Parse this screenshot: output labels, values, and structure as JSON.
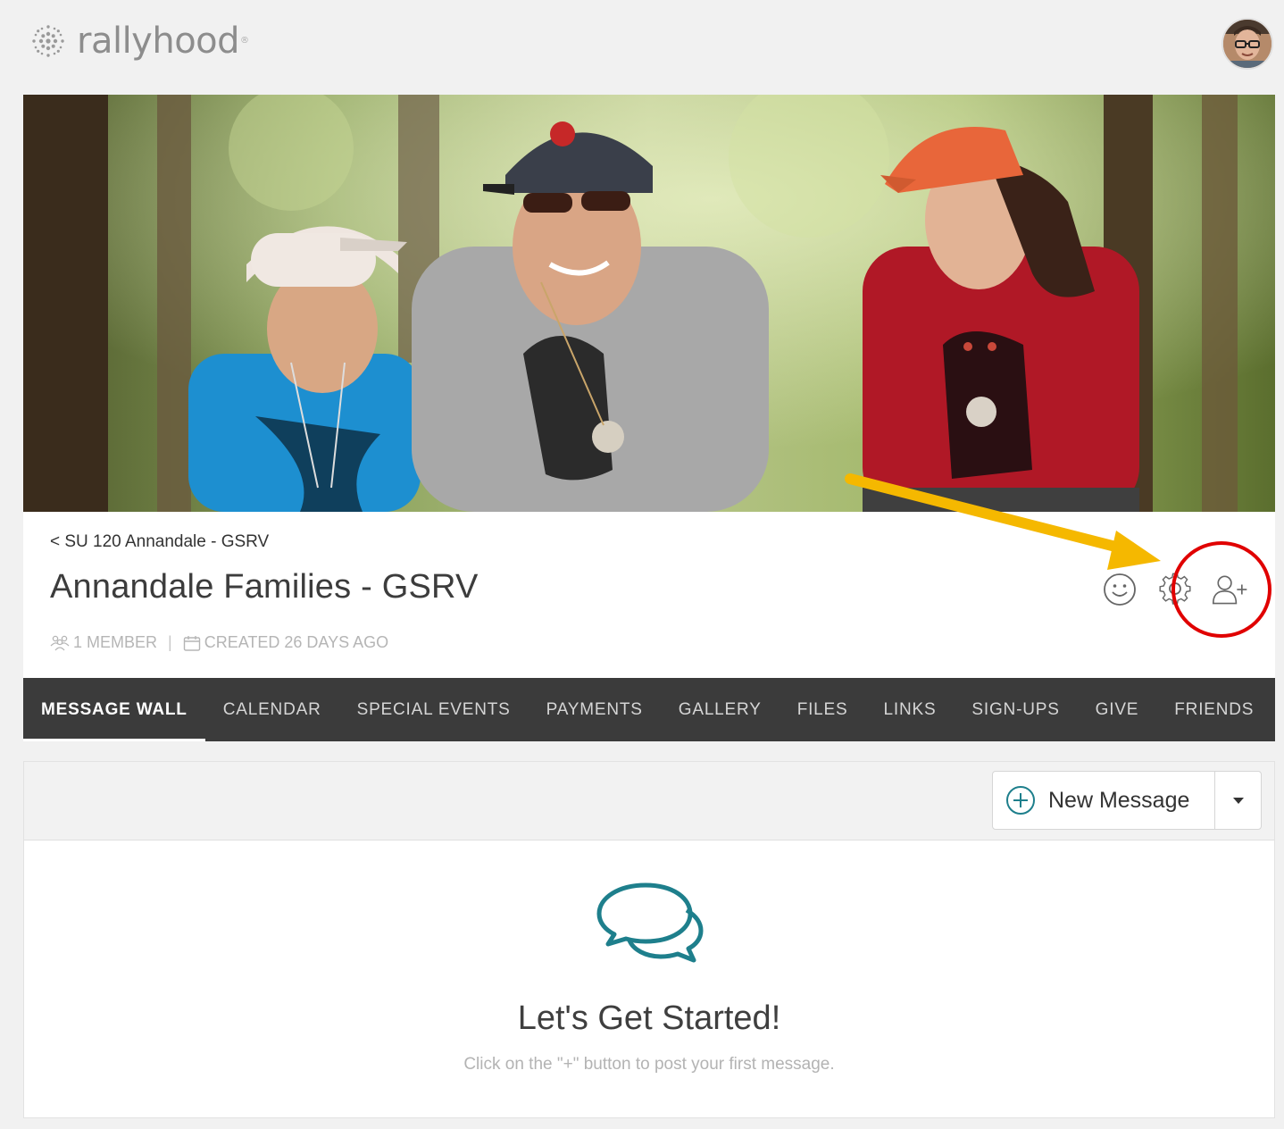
{
  "app": {
    "logo_text": "rallyhood",
    "logo_tm": "®"
  },
  "group": {
    "breadcrumb": "< SU 120 Annandale - GSRV",
    "title": "Annandale Families - GSRV",
    "members": "1 MEMBER",
    "meta_separator": "|",
    "created": "CREATED 26 DAYS AGO"
  },
  "actions": [
    {
      "name": "emoji-icon"
    },
    {
      "name": "gear-icon"
    },
    {
      "name": "add-user-icon"
    }
  ],
  "nav": {
    "tabs": [
      {
        "label": "MESSAGE WALL",
        "active": true
      },
      {
        "label": "CALENDAR"
      },
      {
        "label": "SPECIAL EVENTS"
      },
      {
        "label": "PAYMENTS"
      },
      {
        "label": "GALLERY"
      },
      {
        "label": "FILES"
      },
      {
        "label": "LINKS"
      },
      {
        "label": "SIGN-UPS"
      },
      {
        "label": "GIVE"
      },
      {
        "label": "FRIENDS"
      }
    ]
  },
  "message_wall": {
    "new_message_label": "New Message",
    "empty_title": "Let's Get Started!",
    "empty_subtitle": "Click on the \"+\" button to post your first message."
  },
  "colors": {
    "nav_bg": "#3b3b3b",
    "accent_teal": "#1e7f8c",
    "annotation_arrow": "#f5b800",
    "annotation_circle": "#e00000"
  }
}
